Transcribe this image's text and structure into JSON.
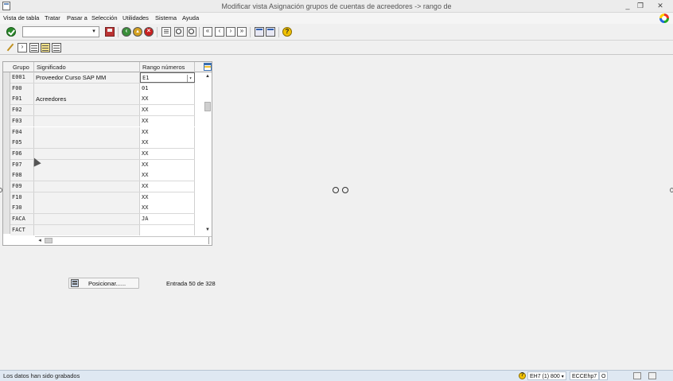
{
  "window": {
    "title": "Modificar vista Asignación grupos de cuentas de acreedores -> rango de",
    "minimize": "_",
    "restore": "❐",
    "close": "✕"
  },
  "menu": [
    "Vista de tabla",
    "Tratar",
    "Pasar a",
    "Selección",
    "Utilidades",
    "Sistema",
    "Ayuda"
  ],
  "command_field": {
    "value": "",
    "dropdown": "▾"
  },
  "grid": {
    "columns": [
      "Grupo",
      "Significado",
      "Rango números"
    ],
    "rows": [
      {
        "grupo": "E001",
        "significado": "Proveedor Curso SAP MM",
        "rango": "E1"
      },
      {
        "grupo": "F00",
        "significado": "",
        "rango": "01"
      },
      {
        "grupo": "F01",
        "significado": "Acreedores",
        "rango": "XX"
      },
      {
        "grupo": "F02",
        "significado": "",
        "rango": "XX"
      },
      {
        "grupo": "F03",
        "significado": "",
        "rango": "XX"
      },
      {
        "grupo": "F04",
        "significado": "",
        "rango": "XX"
      },
      {
        "grupo": "F05",
        "significado": "",
        "rango": "XX"
      },
      {
        "grupo": "F06",
        "significado": "",
        "rango": "XX"
      },
      {
        "grupo": "F07",
        "significado": "",
        "rango": "XX"
      },
      {
        "grupo": "F08",
        "significado": "",
        "rango": "XX"
      },
      {
        "grupo": "F09",
        "significado": "",
        "rango": "XX"
      },
      {
        "grupo": "F10",
        "significado": "",
        "rango": "XX"
      },
      {
        "grupo": "F30",
        "significado": "",
        "rango": "XX"
      },
      {
        "grupo": "FACA",
        "significado": "",
        "rango": "JA"
      },
      {
        "grupo": "FACT",
        "significado": "",
        "rango": ""
      }
    ],
    "dropdown_arrow": "▾",
    "scroll_up": "▲",
    "scroll_down": "▼",
    "scroll_left": "◂"
  },
  "position_button": {
    "label": "Posicionar......"
  },
  "entry_info": "Entrada 50 de 328",
  "status": {
    "message": "Los datos han sido grabados",
    "system": "EH7 (1) 800",
    "system_arrow": "▾",
    "server": "ECCEhp7",
    "mode": "O"
  }
}
